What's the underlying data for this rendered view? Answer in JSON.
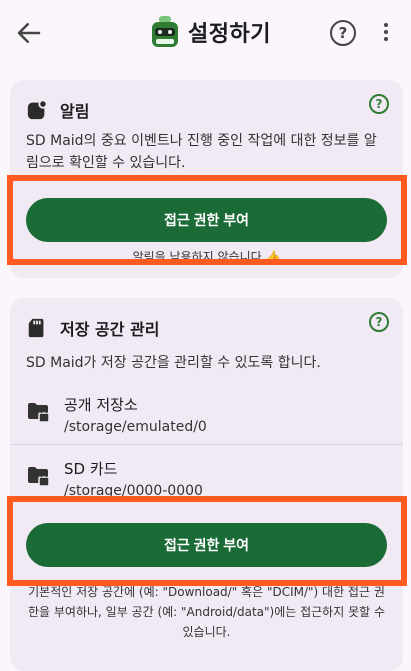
{
  "header": {
    "title": "설정하기",
    "back_icon": "arrow-left-icon",
    "help_icon": "help-circle-icon",
    "more_icon": "more-vert-icon",
    "help_glyph": "?"
  },
  "notifications_card": {
    "title": "알림",
    "help_glyph": "?",
    "description": "SD Maid의 중요 이벤트나 진행 중인 작업에 대한 정보를 알림으로 확인할 수 있습니다.",
    "button_label": "접근 권한 부여",
    "status_note": "알림을 남용하지 않습니다 👍"
  },
  "storage_card": {
    "title": "저장 공간 관리",
    "help_glyph": "?",
    "description": "SD Maid가 저장 공간을 관리할 수 있도록 합니다.",
    "locations": [
      {
        "name": "공개 저장소",
        "path": "/storage/emulated/0"
      },
      {
        "name": "SD 카드",
        "path": "/storage/0000-0000"
      }
    ],
    "button_label": "접근 권한 부여",
    "footer_note": "기본적인 저장 공간에 (예: \"Download/\" 혹은 \"DCIM/\") 대한 접근 권한을 부여하나, 일부 공간 (예: \"Android/data\")에는 접근하지 못할 수 있습니다."
  },
  "colors": {
    "accent": "#1b6b37",
    "highlight": "#ff5a1f",
    "card_bg": "#f1eaf5"
  }
}
